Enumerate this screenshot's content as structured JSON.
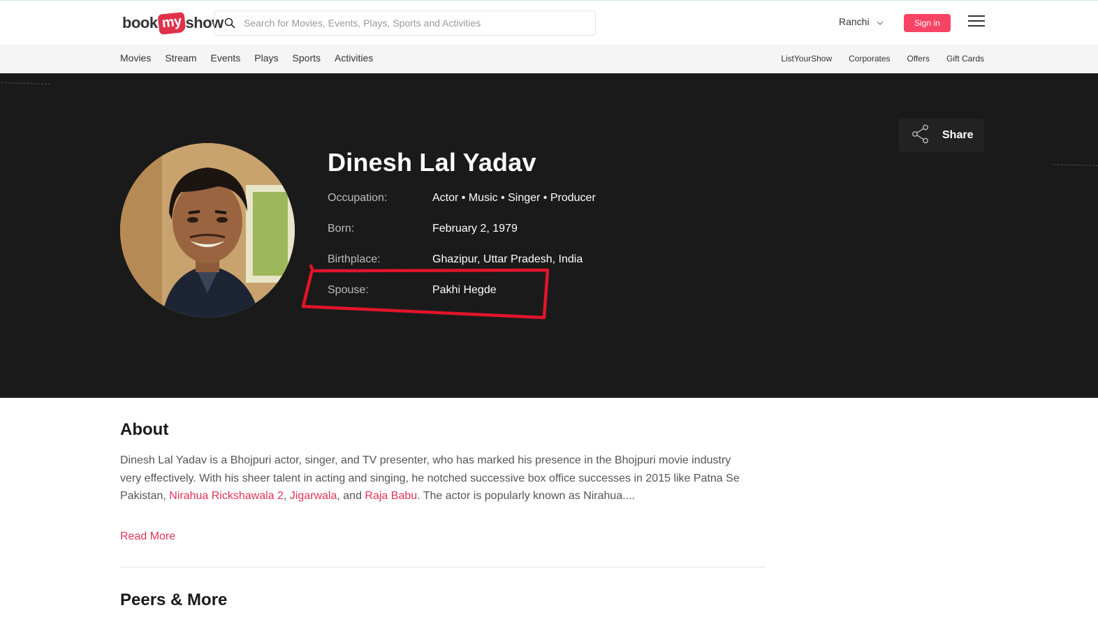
{
  "header": {
    "logo": {
      "part1": "book",
      "part2": "my",
      "part3": "show"
    },
    "search_placeholder": "Search for Movies, Events, Plays, Sports and Activities",
    "city": "Ranchi",
    "signin_label": "Sign in"
  },
  "subnav": {
    "left": [
      "Movies",
      "Stream",
      "Events",
      "Plays",
      "Sports",
      "Activities"
    ],
    "right": [
      "ListYourShow",
      "Corporates",
      "Offers",
      "Gift Cards"
    ]
  },
  "profile": {
    "name": "Dinesh Lal Yadav",
    "share_label": "Share",
    "rows": [
      {
        "label": "Occupation:",
        "value": "Actor • Music • Singer • Producer"
      },
      {
        "label": "Born:",
        "value": "February 2, 1979"
      },
      {
        "label": "Birthplace:",
        "value": "Ghazipur, Uttar Pradesh, India"
      },
      {
        "label": "Spouse:",
        "value": "Pakhi Hegde"
      }
    ]
  },
  "about": {
    "title": "About",
    "text_1": "Dinesh Lal Yadav is a Bhojpuri actor, singer, and TV presenter, who has marked his presence in the Bhojpuri movie industry very effectively. With his sheer talent in acting and singing, he notched successive box office successes in 2015 like Patna Se Pakistan, ",
    "link_1": "Nirahua Rickshawala 2",
    "sep_1": ", ",
    "link_2": "Jigarwala",
    "sep_2": ", and ",
    "link_3": "Raja Babu",
    "text_2": ". The actor is popularly known as Nirahua....",
    "read_more": "Read More"
  },
  "peers": {
    "title": "Peers & More"
  },
  "colors": {
    "brand": "#f84464",
    "link": "#dc3558",
    "banner_bg": "#1a1a1a",
    "annotation": "#e0142b"
  },
  "icons": [
    "search-icon",
    "chevron-down-icon",
    "hamburger-menu-icon",
    "share-icon"
  ]
}
